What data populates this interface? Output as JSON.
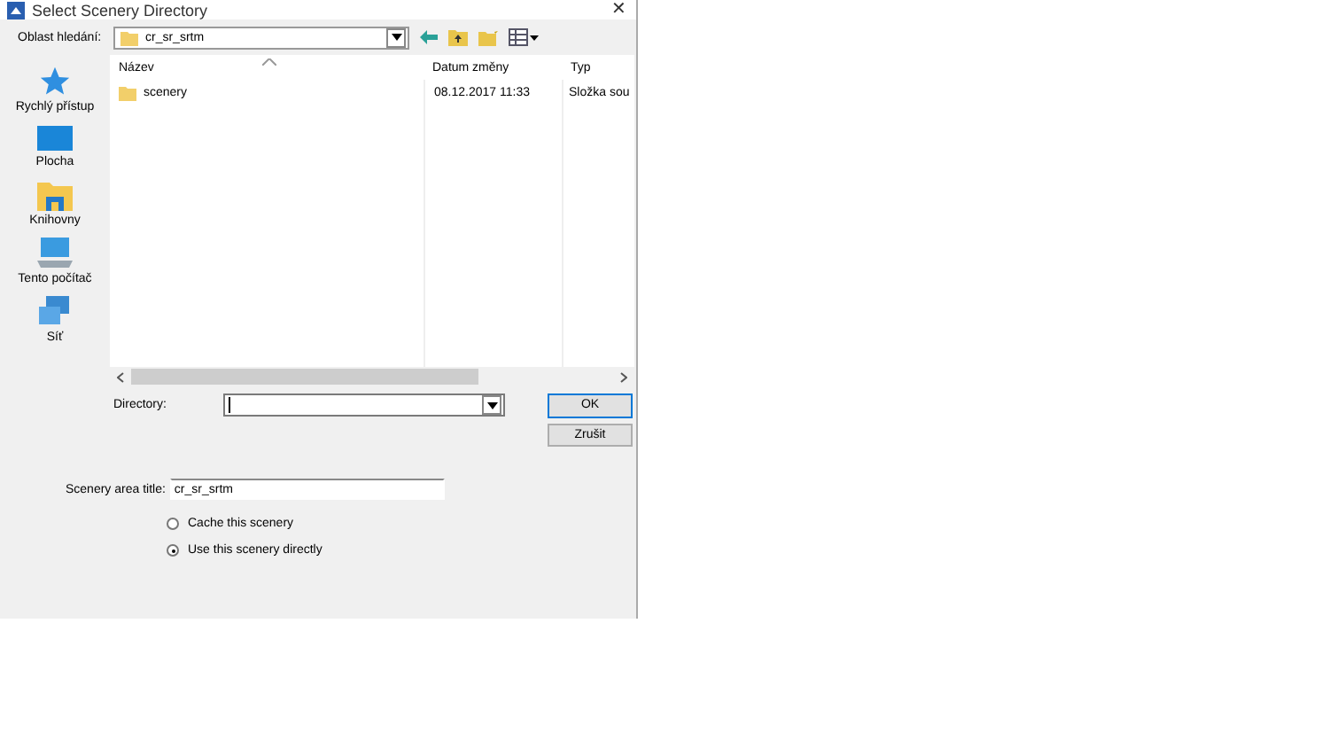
{
  "window": {
    "title": "Select Scenery Directory",
    "close": "✕"
  },
  "look_in": {
    "label": "Oblast hledání:",
    "value": "cr_sr_srtm"
  },
  "places": [
    {
      "label": "Rychlý přístup",
      "kind": "star"
    },
    {
      "label": "Plocha",
      "kind": "desktop"
    },
    {
      "label": "Knihovny",
      "kind": "library"
    },
    {
      "label": "Tento počítač",
      "kind": "computer"
    },
    {
      "label": "Síť",
      "kind": "network"
    }
  ],
  "table": {
    "columns": [
      "Název",
      "Datum změny",
      "Typ"
    ],
    "rows": [
      {
        "name": "scenery",
        "date": "08.12.2017 11:33",
        "type": "Složka sou"
      }
    ]
  },
  "directory": {
    "label": "Directory:"
  },
  "buttons": [
    "OK",
    "Zrušit"
  ],
  "scenery_title": {
    "label": "Scenery area title:",
    "value": "cr_sr_srtm"
  },
  "options": [
    {
      "label": "Cache this scenery",
      "selected": false
    },
    {
      "label": "Use this scenery directly",
      "selected": true
    }
  ]
}
